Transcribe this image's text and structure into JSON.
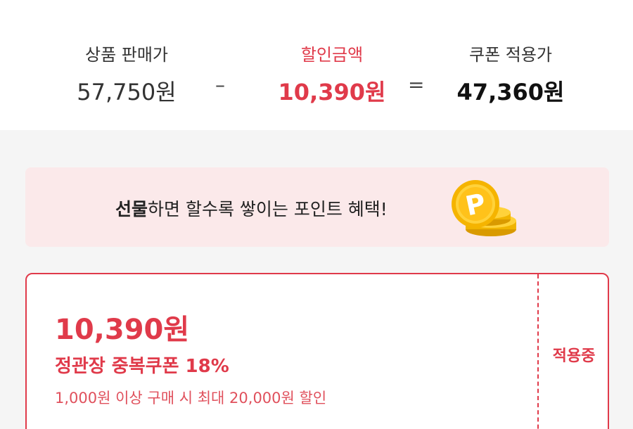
{
  "summary": {
    "price_label": "상품 판매가",
    "price_value": "57,750원",
    "minus_symbol": "–",
    "discount_label": "할인금액",
    "discount_value": "10,390원",
    "equals_symbol": "=",
    "final_label": "쿠폰 적용가",
    "final_value": "47,360원"
  },
  "banner": {
    "highlight": "선물",
    "text": "하면 할수록 쌓이는 포인트 혜택!",
    "coin_letter": "P",
    "coin_icon": "gold-coin-stack-icon"
  },
  "coupon": {
    "amount": "10,390원",
    "name": "정관장 중복쿠폰 18%",
    "description": "1,000원 이상 구매 시 최대 20,000원 할인",
    "status": "적용중"
  },
  "colors": {
    "accent": "#e03a4a",
    "banner_bg": "#fbe9ea",
    "page_bg": "#f5f5f5",
    "coin": "#f5b400"
  }
}
